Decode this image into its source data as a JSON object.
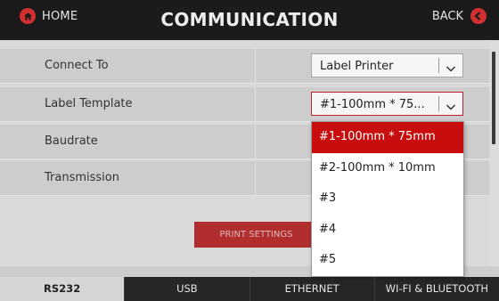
{
  "header": {
    "home_label": "HOME",
    "title": "COMMUNICATION",
    "back_label": "BACK",
    "home_icon": "home-icon",
    "back_icon": "back-arrow-icon",
    "accent": "#d23030"
  },
  "settings": [
    {
      "label": "Connect To",
      "value": "Label Printer"
    },
    {
      "label": "Label Template",
      "value": "#1-100mm * 75..."
    },
    {
      "label": "Baudrate"
    },
    {
      "label": "Transmission"
    }
  ],
  "print_button": "PRINT SETTINGS",
  "dropdown": {
    "options": [
      "#1-100mm * 75mm",
      "#2-100mm * 10mm",
      "#3",
      "#4",
      "#5"
    ],
    "selected_index": 0,
    "selected_color": "#c70d0d"
  },
  "tabs": [
    "RS232",
    "USB",
    "ETHERNET",
    "WI-FI & BLUETOOTH"
  ],
  "active_tab": "RS232"
}
